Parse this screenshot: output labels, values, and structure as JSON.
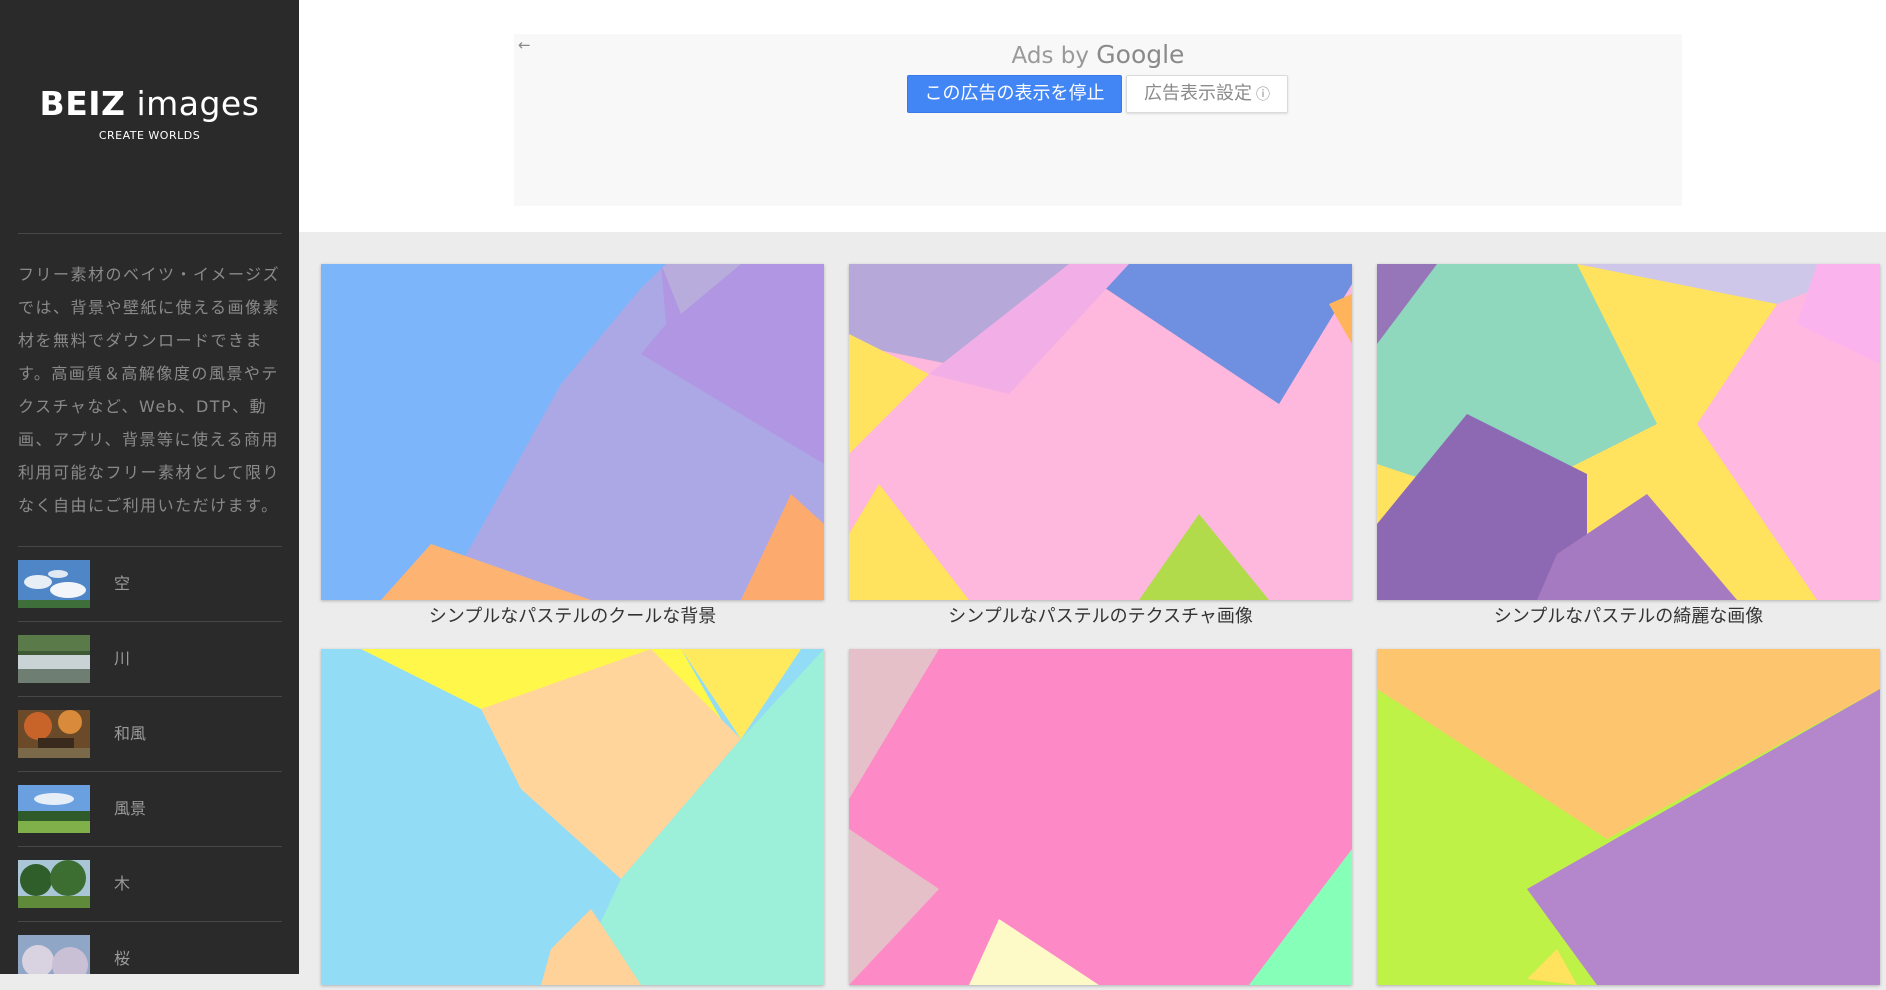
{
  "sidebar": {
    "logo": {
      "brand_bold": "BEIZ",
      "brand_light": "images",
      "tagline": "CREATE WORLDS"
    },
    "description": "フリー素材のベイツ・イメージズでは、背景や壁紙に使える画像素材を無料でダウンロードできます。高画質＆高解像度の風景やテクスチャなど、Web、DTP、動画、アプリ、背景等に使える商用利用可能なフリー素材として限りなく自由にご利用いただけます。",
    "categories": [
      {
        "label": "空"
      },
      {
        "label": "川"
      },
      {
        "label": "和風"
      },
      {
        "label": "風景"
      },
      {
        "label": "木"
      },
      {
        "label": "桜"
      }
    ]
  },
  "ad": {
    "back_arrow": "←",
    "ads_by": "Ads by",
    "google": "Google",
    "stop_button": "この広告の表示を停止",
    "settings_button": "広告表示設定",
    "info_icon": "ⓘ"
  },
  "gallery": {
    "items": [
      {
        "caption": "シンプルなパステルのクールな背景"
      },
      {
        "caption": "シンプルなパステルのテクスチャ画像"
      },
      {
        "caption": "シンプルなパステルの綺麗な画像"
      },
      {
        "caption": ""
      },
      {
        "caption": ""
      },
      {
        "caption": ""
      }
    ]
  },
  "colors": {
    "sidebar_bg": "#2a2a2a",
    "ad_button": "#4285f4",
    "page_bg": "#ececec"
  }
}
